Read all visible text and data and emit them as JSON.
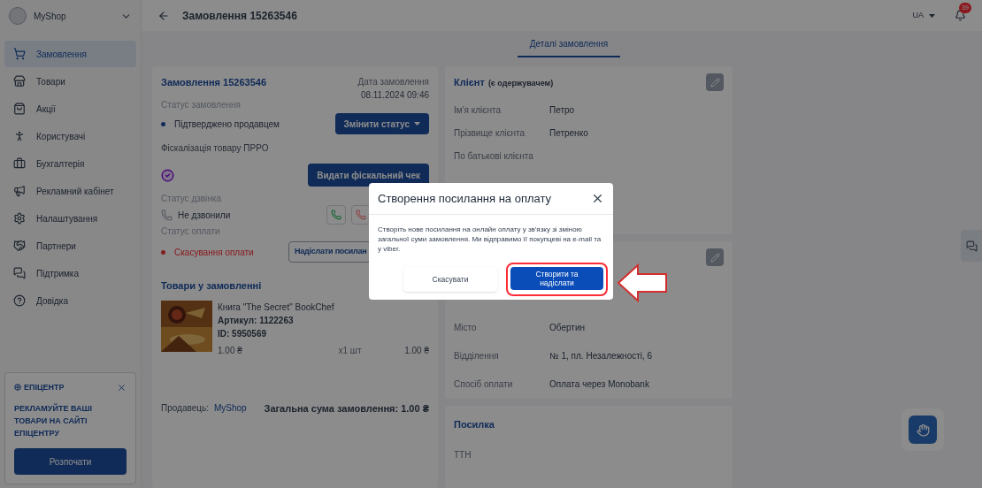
{
  "sidebar": {
    "shop": "MyShop",
    "items": [
      {
        "label": "Замовлення",
        "selected": true
      },
      {
        "label": "Товари",
        "selected": false
      },
      {
        "label": "Акції",
        "selected": false
      },
      {
        "label": "Користувачі",
        "selected": false
      },
      {
        "label": "Бухгалтерія",
        "selected": false
      },
      {
        "label": "Рекламний кабінет",
        "selected": false
      },
      {
        "label": "Налаштування",
        "selected": false
      },
      {
        "label": "Партнери",
        "selected": false
      },
      {
        "label": "Підтримка",
        "selected": false
      },
      {
        "label": "Довідка",
        "selected": false
      }
    ]
  },
  "promo": {
    "logo": "ЕПІЦЕНТР",
    "text": "РЕКЛАМУЙТЕ ВАШІ ТОВАРИ НА САЙТІ ЕПІЦЕНТРУ",
    "button": "Розпочати"
  },
  "header": {
    "title": "Замовлення 15263546",
    "language": "UA",
    "notifications": "39"
  },
  "tabs": [
    {
      "label": "Деталі замовлення",
      "selected": true
    }
  ],
  "order": {
    "title": "Замовлення 15263546",
    "date_label": "Дата замовлення",
    "date": "08.11.2024 09:46",
    "order_status": {
      "label": "Статус замовлення",
      "value": "Підтверджено продавцем",
      "kind": "confirmed",
      "button": "Змінити статус"
    },
    "fiscal": {
      "label": "Фіскалізація товару ПРРО",
      "button": "Видати фіскальний чек"
    },
    "call_status": {
      "label": "Статус дзвінка",
      "value": "Не дзвонили"
    },
    "payment_status": {
      "label": "Статус оплати",
      "value": "Скасування оплати",
      "kind": "cancelled",
      "button": "Надіслати посилан"
    },
    "items_title": "Товари у замовленні",
    "items": [
      {
        "kind": "picture",
        "name": "Книга \"The Secret\" BookChef",
        "sku": "Артикул: 1122263",
        "id": "ID: 5950569",
        "price": "1.00 ₴",
        "quantity": "x1 шт",
        "total": "1.00 ₴"
      }
    ],
    "seller_label": "Продавець:",
    "seller": "MyShop",
    "sum": "Загальна сума замовлення: 1.00 ₴"
  },
  "client": {
    "title": "Клієнт",
    "note": "(є одержувачем)",
    "rows": [
      {
        "label": "Ім'я клієнта",
        "value": "Петро"
      },
      {
        "label": "Прізвище клієнта",
        "value": "Петренко"
      },
      {
        "label": "По батькові клієнта"
      }
    ]
  },
  "delivery": {
    "rows": [
      {
        "label": "Місто",
        "value": "Обертин"
      },
      {
        "label": "Відділення",
        "value": "№ 1, пл. Незалежності, 6"
      },
      {
        "label": "Спосіб оплати",
        "value": "Оплата через Monobank"
      }
    ]
  },
  "parcel": {
    "title": "Посилка",
    "rows": [
      {
        "label": "ТТН"
      }
    ]
  },
  "dialog": {
    "title": "Створення посилання на оплату",
    "text": "Створіть нове посилання на онлайн оплату у зв'язку зі зміною загальної суми замовлення. Ми відправимо її покупцеві на e-mail та у viber.",
    "cancel": "Скасувати",
    "confirm": "Створити та надіслати"
  }
}
